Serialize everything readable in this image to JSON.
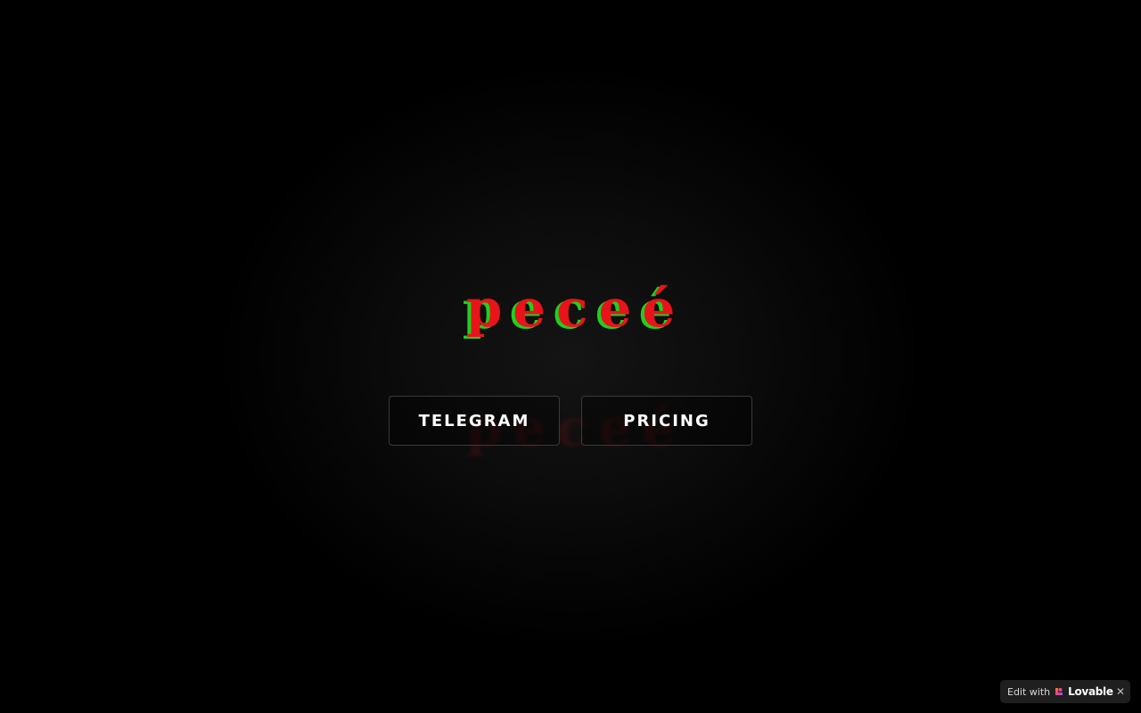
{
  "brand": {
    "logo_text": "pecеé",
    "primary_color": "#e8141a",
    "shadow_color": "#1fd11f"
  },
  "actions": {
    "telegram_label": "TELEGRAM",
    "pricing_label": "PRICING"
  },
  "badge": {
    "prefix": "Edit with",
    "brand_name": "Lovable",
    "logo_icon": "lovable-heart-icon",
    "close_icon": "close-icon",
    "close_glyph": "✕"
  }
}
